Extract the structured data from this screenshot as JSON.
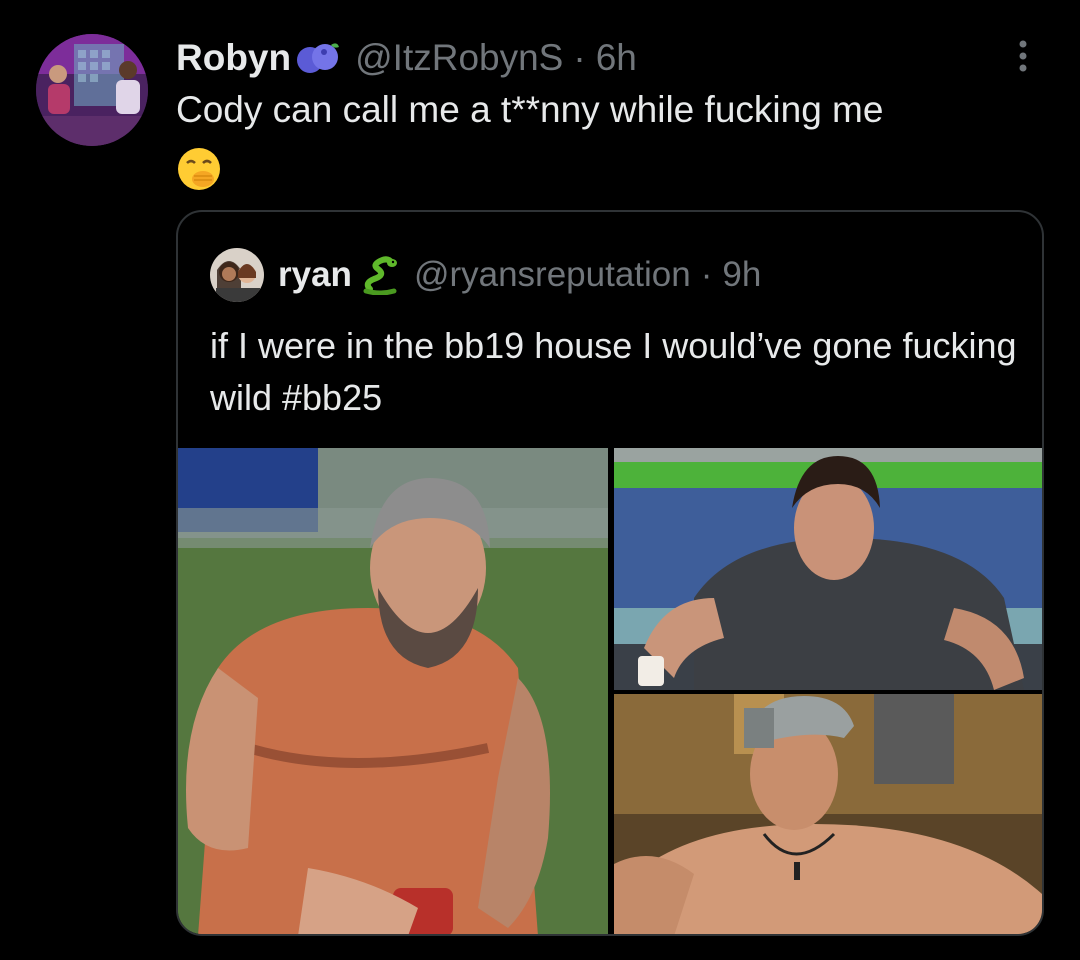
{
  "tweet": {
    "display_name": "Robyn",
    "badge_icon": "blueberry-emoji-icon",
    "handle": "@ItzRobynS",
    "separator": "·",
    "time": "6h",
    "text": "Cody can call me a t**nny while fucking me",
    "emoji_icon": "face-with-hand-over-mouth-emoji-icon"
  },
  "quote": {
    "display_name": "ryan",
    "emoji_icon": "snake-emoji-icon",
    "handle": "@ryansreputation",
    "separator": "·",
    "time": "9h",
    "text": "if I were in the bb19 house I would’ve gone fucking wild #bb25",
    "media": [
      {
        "description": "man-with-grey-beard-orange-tank-top"
      },
      {
        "description": "man-in-grey-tshirt-on-couch"
      },
      {
        "description": "shirtless-man-in-backwards-cap"
      }
    ]
  },
  "colors": {
    "background": "#000000",
    "text_primary": "#e7e9ea",
    "text_secondary": "#71767b",
    "border": "#2f3336"
  }
}
